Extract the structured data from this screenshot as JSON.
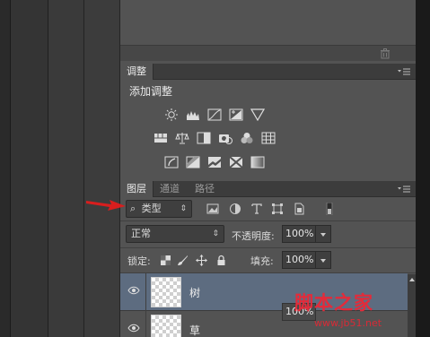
{
  "top_panel": {
    "trash_icon": "trash-icon"
  },
  "adjustments": {
    "tab_label": "调整",
    "heading": "添加调整",
    "icons": [
      "brightness-contrast-icon",
      "levels-icon",
      "curves-icon",
      "exposure-icon",
      "vibrance-icon",
      "hue-saturation-icon",
      "color-balance-icon",
      "black-white-icon",
      "photo-filter-icon",
      "channel-mixer-icon",
      "color-lookup-icon",
      "invert-icon",
      "posterize-icon",
      "threshold-icon",
      "selective-color-icon",
      "gradient-map-icon"
    ]
  },
  "layers_panel": {
    "tabs": [
      {
        "label": "图层",
        "active": true
      },
      {
        "label": "通道",
        "active": false
      },
      {
        "label": "路径",
        "active": false
      }
    ],
    "filter": {
      "search_glyph": "⌕",
      "type_label": "类型",
      "icons": [
        "image-filter-icon",
        "adjustment-filter-icon",
        "text-filter-icon",
        "shape-filter-icon",
        "smart-object-filter-icon",
        "filter-toggle-icon"
      ]
    },
    "blend_mode": "正常",
    "opacity_label": "不透明度:",
    "opacity_value": "100%",
    "lock_label": "锁定:",
    "fill_label": "填充:",
    "fill_value": "100%",
    "layers": [
      {
        "name": "树",
        "selected": true
      },
      {
        "name": "草",
        "selected": false
      }
    ],
    "floating_value": "100%"
  },
  "watermark": {
    "title": "脚本之家",
    "url": "www.jb51.net"
  },
  "colors": {
    "panel_bg": "#535353",
    "selected_row": "#5d6c80",
    "watermark_red": "#e32b3a",
    "arrow_red": "#d81e1e"
  }
}
